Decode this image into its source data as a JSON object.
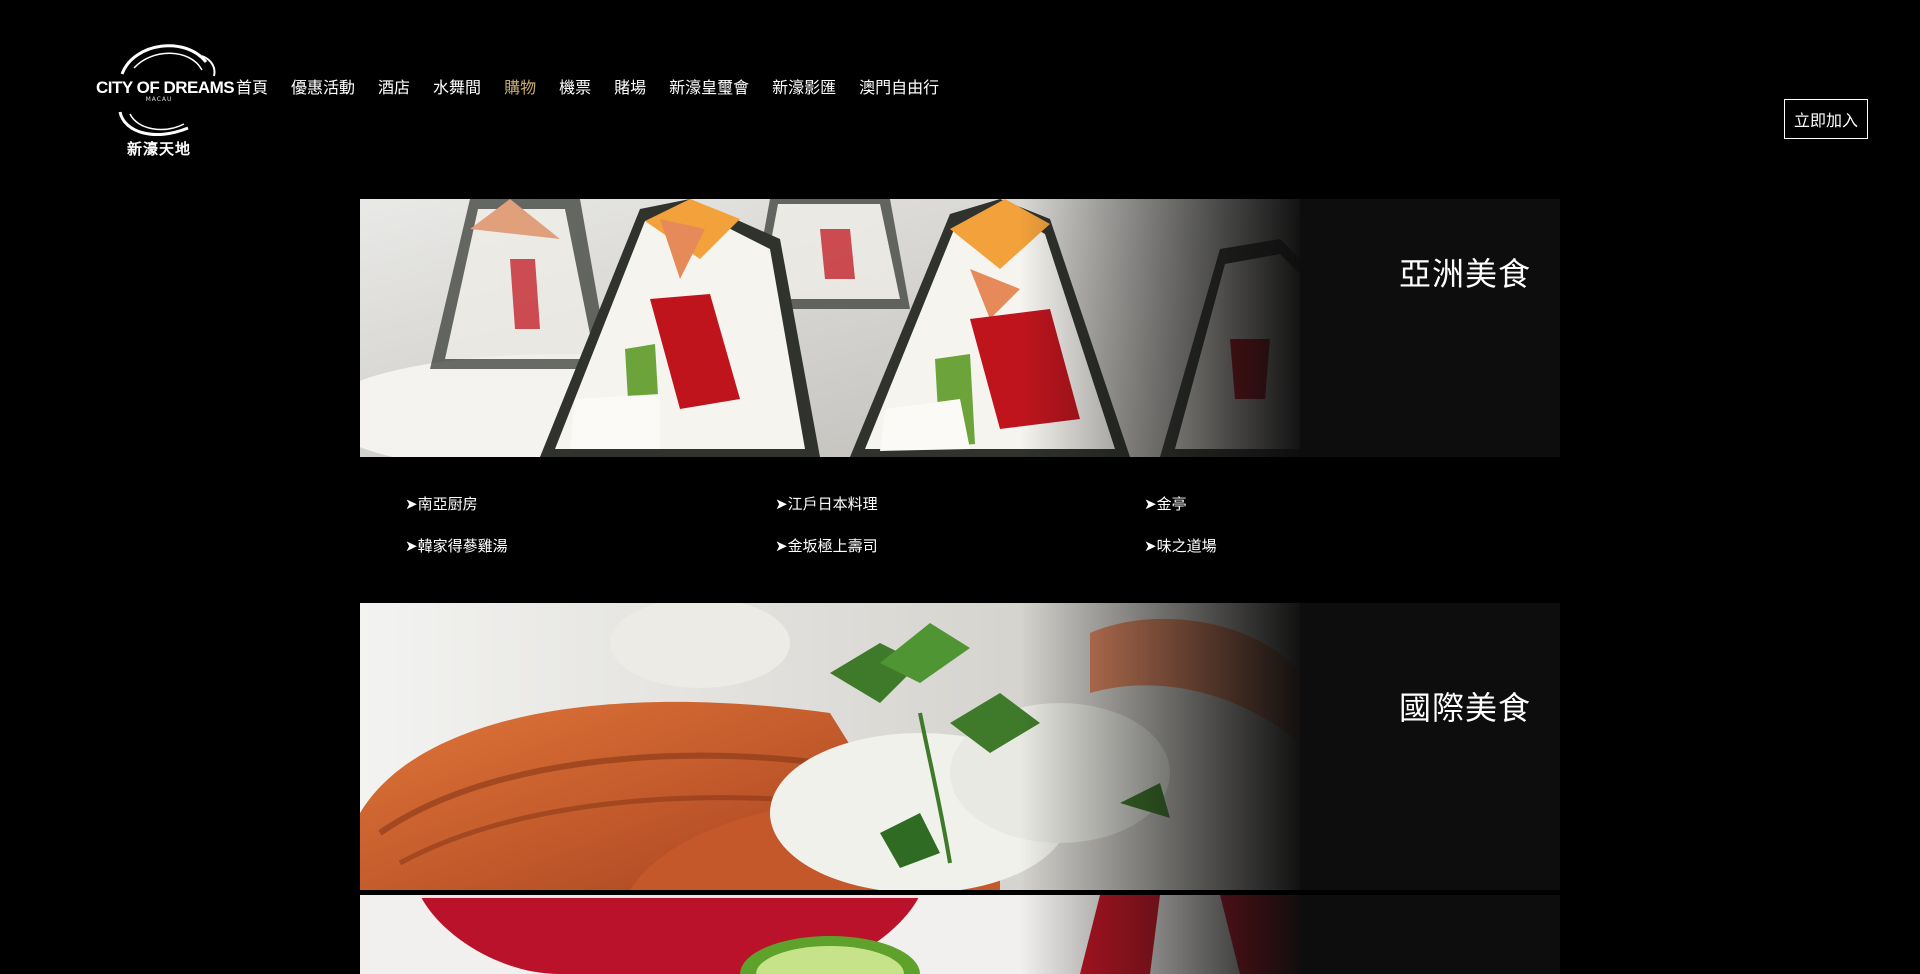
{
  "logo": {
    "brand": "CITY OF DREAMS",
    "sub": "MACAU",
    "chinese": "新濠天地"
  },
  "nav": {
    "items": [
      {
        "label": "首頁"
      },
      {
        "label": "優惠活動"
      },
      {
        "label": "酒店"
      },
      {
        "label": "水舞間"
      },
      {
        "label": "購物",
        "active": true
      },
      {
        "label": "機票"
      },
      {
        "label": "賭場"
      },
      {
        "label": "新濠皇璽會"
      },
      {
        "label": "新濠影匯"
      },
      {
        "label": "澳門自由行"
      }
    ],
    "active_color": "#c9ad6e"
  },
  "join_button": {
    "label": "立即加入"
  },
  "sections": {
    "asian": {
      "title": "亞洲美食",
      "restaurants": [
        {
          "label": "➤南亞厨房"
        },
        {
          "label": "➤江戶日本料理"
        },
        {
          "label": "➤金亭"
        },
        {
          "label": "➤韓家得蔘雞湯"
        },
        {
          "label": "➤金坂極上壽司"
        },
        {
          "label": "➤味之道場"
        }
      ]
    },
    "international": {
      "title": "國際美食"
    }
  },
  "colors": {
    "background": "#000000",
    "banner_panel": "#0d0d0d",
    "text": "#ffffff"
  }
}
